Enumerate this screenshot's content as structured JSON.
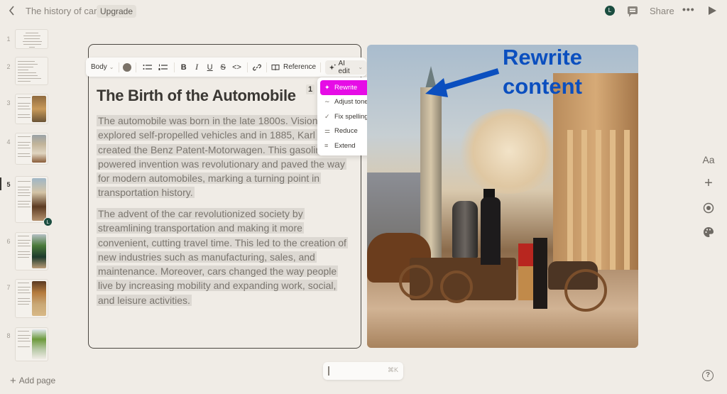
{
  "topbar": {
    "back_icon": "chevron-left-icon",
    "title": "The history of cars",
    "upgrade_label": "Upgrade",
    "avatar_initial": "L",
    "comment_icon": "comment-icon",
    "share_label": "Share",
    "more_label": "•••",
    "play_icon": "play-icon"
  },
  "sidebar": {
    "pages": [
      {
        "number": "1",
        "title": "From Horseless Carriages to Autonomous Vehicles: A Journey Through the History of Cars",
        "active": false
      },
      {
        "number": "2",
        "title": "Contents",
        "active": false
      },
      {
        "number": "3",
        "title": "The Invention of the Wheel",
        "active": false
      },
      {
        "number": "4",
        "title": "The First Self-Propelled Vehicles",
        "active": false
      },
      {
        "number": "5",
        "title": "The Birth of the Automobile",
        "active": true
      },
      {
        "number": "6",
        "title": "The Ford Model T",
        "active": false
      },
      {
        "number": "7",
        "title": "The Rise of Mass Production",
        "active": false
      },
      {
        "number": "8",
        "title": "The Golden Age of Automobiles",
        "active": false
      }
    ],
    "collaborator_initial": "L",
    "add_page_label": "Add page"
  },
  "toolbar": {
    "style_label": "Body",
    "reference_label": "Reference",
    "ai_edit_label": "AI edit",
    "buttons": [
      "bullet-list",
      "numbered-list",
      "bold",
      "italic",
      "underline",
      "strikethrough",
      "code",
      "link"
    ]
  },
  "ai_menu": {
    "items": [
      {
        "label": "Rewrite",
        "icon": "sparkle-icon",
        "active": true
      },
      {
        "label": "Adjust tone",
        "icon": "wave-icon",
        "submenu": true
      },
      {
        "label": "Fix spelling & grammar",
        "icon": "check-icon"
      },
      {
        "label": "Reduce",
        "icon": "reduce-icon"
      },
      {
        "label": "Extend",
        "icon": "extend-icon"
      }
    ]
  },
  "card": {
    "heading": "The Birth of the Automobile",
    "footnote": "1",
    "paragraph1": "The automobile was born in the late 1800s. Visionaries explored self-propelled vehicles and in 1885, Karl Benz created the Benz Patent-Motorwagen. This gasoline-powered invention was revolutionary and paved the way for modern automobiles, marking a turning point in transportation history.",
    "paragraph2": "The advent of the car revolutionized society by streamlining transportation and making it more convenient, cutting travel time. This led to the creation of new industries such as manufacturing, sales, and maintenance. Moreover, cars changed the way people live by increasing mobility and expanding work, social, and leisure activities."
  },
  "annotation": {
    "line1": "Rewrite",
    "line2": "content",
    "color": "#0b4fbf"
  },
  "right_rail": {
    "text_style_label": "Aa",
    "add_label": "+",
    "record_icon": "record-icon",
    "palette_icon": "palette-icon"
  },
  "command_bar": {
    "shortcut": "⌘K"
  },
  "help_label": "?",
  "colors": {
    "accent_menu": "#e60ce6",
    "avatar": "#1b4d40",
    "background": "#f0ece6"
  }
}
